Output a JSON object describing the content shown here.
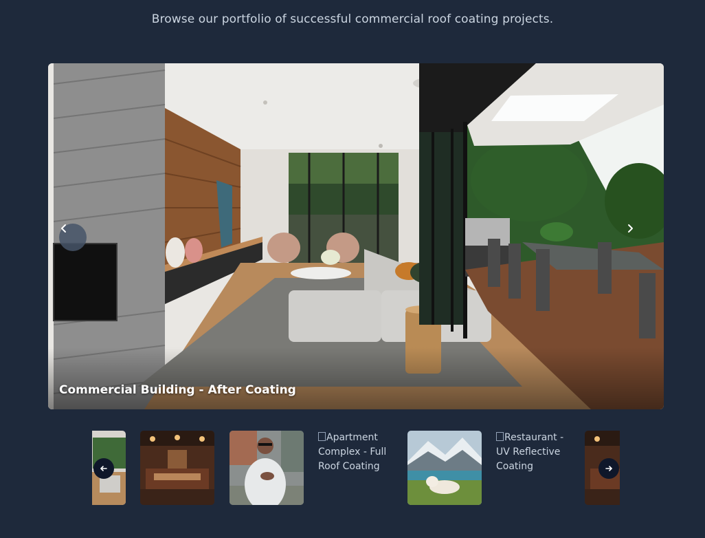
{
  "header": {
    "subtitle": "Browse our portfolio of successful commercial roof coating projects."
  },
  "carousel": {
    "current_caption": "Commercial Building - After Coating",
    "prev_icon": "chevron-left-icon",
    "next_icon": "chevron-right-icon"
  },
  "thumbnails": {
    "items": [
      {
        "alt": "Living room interior",
        "loaded": true
      },
      {
        "alt": "Restaurant interior",
        "loaded": true
      },
      {
        "alt": "Man speaking outdoors",
        "loaded": true
      },
      {
        "alt": "Apartment Complex - Full Roof Coating",
        "loaded": false
      },
      {
        "alt": "Lamb by mountain lake",
        "loaded": true
      },
      {
        "alt": "Restaurant - UV Reflective Coating",
        "loaded": false
      },
      {
        "alt": "Restaurant interior",
        "loaded": true
      }
    ],
    "broken_1_text": "Apartment Complex - Full Roof Coating",
    "broken_2_text": "Restaurant - UV Reflective Coating",
    "prev_icon": "arrow-left-icon",
    "next_icon": "arrow-right-icon"
  },
  "colors": {
    "background": "#1e293b",
    "text": "#cbd5e1",
    "nav_button_dark": "#0f172a"
  }
}
